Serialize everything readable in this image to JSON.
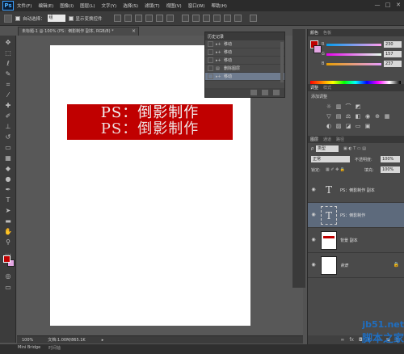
{
  "menu": {
    "logo": "Ps",
    "items": [
      "文件(F)",
      "编辑(E)",
      "图像(I)",
      "图层(L)",
      "文字(Y)",
      "选择(S)",
      "滤镜(T)",
      "视图(V)",
      "窗口(W)",
      "帮助(H)"
    ],
    "window_controls": [
      "—",
      "□",
      "✕"
    ]
  },
  "options_bar": {
    "auto_select_label": "自动选择：",
    "auto_select_value": "组",
    "show_transform_label": "显示变换控件"
  },
  "document": {
    "tab_title": "未标题-1 @ 100% (PS：倒影制作 副本, RGB/8) *",
    "tab_close": "×",
    "banner_line1": "PS：倒影制作",
    "banner_line2": "PS：倒影制作",
    "banner_color": "#c00000"
  },
  "status_bar": {
    "zoom": "100%",
    "doc_info": "文档:1.00M/865.1K"
  },
  "bottom_tabs": {
    "mini_bridge": "Mini Bridge",
    "timeline": "时间轴"
  },
  "history": {
    "tab_label": "历史记录",
    "items": [
      {
        "label": "移动",
        "active": false
      },
      {
        "label": "移动",
        "active": false
      },
      {
        "label": "移动",
        "active": false
      },
      {
        "label": "删除图层",
        "active": false
      },
      {
        "label": "移动",
        "active": true
      }
    ]
  },
  "color_panel": {
    "tabs": [
      "颜色",
      "色板"
    ],
    "foreground": "#c00000",
    "background": "#e3a6e3",
    "channels": [
      {
        "label": "R",
        "value": "230"
      },
      {
        "label": "G",
        "value": "157"
      },
      {
        "label": "B",
        "value": "237"
      }
    ]
  },
  "adjustments_panel": {
    "tabs": [
      "调整",
      "样式"
    ],
    "title": "添加调整"
  },
  "layers_panel": {
    "tabs": [
      "图层",
      "通道",
      "路径"
    ],
    "filter_kind": "类型",
    "blend_mode": "正常",
    "opacity_label": "不透明度:",
    "opacity_value": "100%",
    "lock_label": "锁定:",
    "fill_label": "填充:",
    "fill_value": "100%",
    "layers": [
      {
        "name": "PS：倒影制作 副本",
        "type": "text",
        "active": false
      },
      {
        "name": "PS：倒影制作",
        "type": "text",
        "active": true
      },
      {
        "name": "背景 副本",
        "type": "image",
        "active": false
      },
      {
        "name": "背景",
        "type": "background",
        "active": false
      }
    ]
  },
  "watermark": {
    "url": "jb51.net",
    "name": "脚本之家"
  }
}
